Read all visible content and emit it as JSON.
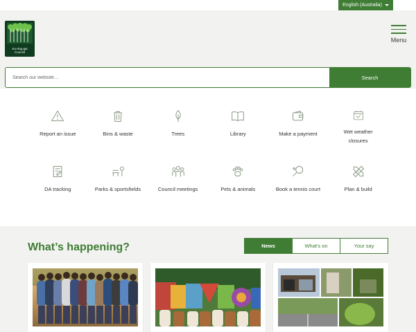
{
  "language": {
    "selected": "English (Australia)"
  },
  "header": {
    "logo_text_line1": "Ku-ring-gai",
    "logo_text_line2": "Council",
    "menu_label": "Menu"
  },
  "search": {
    "placeholder": "Search our website...",
    "button_label": "Search"
  },
  "quick_links": [
    {
      "label": "Report an issue",
      "icon": "warning-triangle-icon"
    },
    {
      "label": "Bins & waste",
      "icon": "bin-icon"
    },
    {
      "label": "Trees",
      "icon": "tree-icon"
    },
    {
      "label": "Library",
      "icon": "book-icon"
    },
    {
      "label": "Make a payment",
      "icon": "wallet-icon"
    },
    {
      "label": "Wet weather closures",
      "icon": "calendar-check-icon"
    },
    {
      "label": "DA tracking",
      "icon": "document-edit-icon"
    },
    {
      "label": "Parks & sportsfields",
      "icon": "park-bench-icon"
    },
    {
      "label": "Council meetings",
      "icon": "people-group-icon"
    },
    {
      "label": "Pets & animals",
      "icon": "paw-icon"
    },
    {
      "label": "Book a tennis court",
      "icon": "tennis-racket-icon"
    },
    {
      "label": "Plan & build",
      "icon": "ruler-pencil-icon"
    }
  ],
  "happening": {
    "title": "What’s happening?",
    "tabs": [
      {
        "label": "News",
        "active": true
      },
      {
        "label": "What's on",
        "active": false
      },
      {
        "label": "Your say",
        "active": false
      }
    ]
  },
  "colors": {
    "brand_green": "#3f7d34",
    "panel_grey": "#f2f2f0",
    "icon_grey": "#8a9a84"
  }
}
